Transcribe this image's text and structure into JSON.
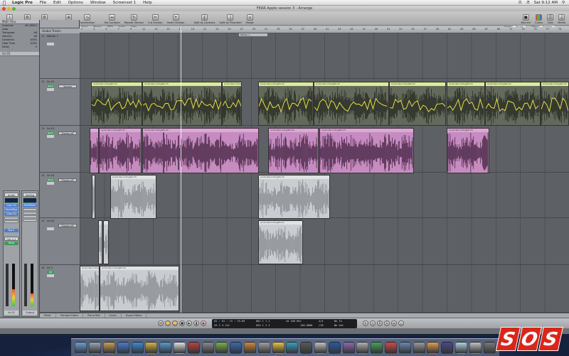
{
  "menubar": {
    "items": [
      "Logic Pro",
      "File",
      "Edit",
      "Options",
      "Window",
      "Screenset 1",
      "Help"
    ],
    "clock": "Sat 9:12 AM"
  },
  "window": {
    "title": "FEAR Apple session 3 - Arrange"
  },
  "toolbar": {
    "left": [
      "Inspector",
      "Preferences",
      "Settings",
      "Auto Zoom",
      "Automation",
      "Set Locators",
      "Repeat Section",
      "Cut Section",
      "Insert Section",
      "Split by Locators",
      "Split by Playhead",
      "Merge"
    ],
    "right": [
      "Bounce",
      "Colors",
      "Lists",
      "Media"
    ]
  },
  "arrange_menu": [
    "Edit",
    "Track",
    "Region",
    "MIDI",
    "Audio",
    "View"
  ],
  "snap": {
    "label": "Snap:",
    "value": "Smart",
    "drag_label": "Drag:",
    "drag_value": "Overlap"
  },
  "inspector": {
    "region_header": "MIDI Thru",
    "params": [
      {
        "k": "Quantize",
        "v": "off (3840)"
      },
      {
        "k": "Loop",
        "v": ""
      },
      {
        "k": "Transpose",
        "v": "off"
      },
      {
        "k": "Velocity",
        "v": "off"
      },
      {
        "k": "Dynamics",
        "v": "100%"
      },
      {
        "k": "Gate Time",
        "v": "100%"
      },
      {
        "k": "Delay",
        "v": "0"
      }
    ],
    "track_header": "Vx 01",
    "strip1": {
      "setting": "Audio",
      "eq": "EQ",
      "inserts": [
        "Chan EQ",
        "SoundToys",
        "Chan EQ"
      ],
      "send": "Bus 2",
      "output": "Out 1-2",
      "read": "Read",
      "name": "Vx 01"
    },
    "strip2": {
      "setting": "Setting",
      "eq": "EQ",
      "inserts": [
        "MultiMeter"
      ],
      "send": "",
      "output": "",
      "read": "",
      "name": "Output"
    }
  },
  "global_tracks": "Global Tracks",
  "marker": "Marker 1",
  "ruler": [
    "1",
    "3",
    "5",
    "7",
    "9",
    "11",
    "13",
    "15",
    "17",
    "19",
    "21",
    "23",
    "25",
    "27",
    "29",
    "31",
    "33",
    "35",
    "37",
    "39",
    "41",
    "43",
    "45",
    "47",
    "49",
    "51",
    "53",
    "55",
    "57",
    "59",
    "61",
    "63",
    "65",
    "67",
    "69",
    "71",
    "73",
    "75",
    "77",
    "79"
  ],
  "tracks": [
    {
      "num": "11",
      "name": "Marker 1",
      "mode": "",
      "auto": ""
    },
    {
      "num": "12",
      "name": "Vx 01",
      "mode": "Read",
      "auto": "Volume"
    },
    {
      "num": "13",
      "name": "Vx 01",
      "mode": "Read",
      "auto": "Display off"
    },
    {
      "num": "14",
      "name": "Vx 01",
      "mode": "Read",
      "auto": "Display off"
    },
    {
      "num": "15",
      "name": "Vx 01",
      "mode": "",
      "auto": "Display off"
    },
    {
      "num": "16",
      "name": "Vx 2",
      "mode": "Off",
      "auto": ""
    }
  ],
  "region_label": "Audio Recording#0.23",
  "bottom_tabs": [
    "Mixer",
    "Sample Editor",
    "Piano Roll",
    "Score",
    "Hyper Editor"
  ],
  "transport": {
    "smpte": "01 : 01 : 15 : 19.05",
    "bars": "43  2  4  114",
    "tempo": "140.0000",
    "sig": "4/4",
    "div": "/16",
    "in": "No In",
    "out": "No Out",
    "sample_rate": "44 100 KHz",
    "locator_l": "001 1 1 1",
    "locator_r": "025 1 1 1"
  },
  "brand": "SOS",
  "colors": {
    "green_region": "#dcea9b",
    "pink_region": "#c68bc0",
    "grey_region": "#c9ccd0",
    "automation": "#e8e04a"
  }
}
